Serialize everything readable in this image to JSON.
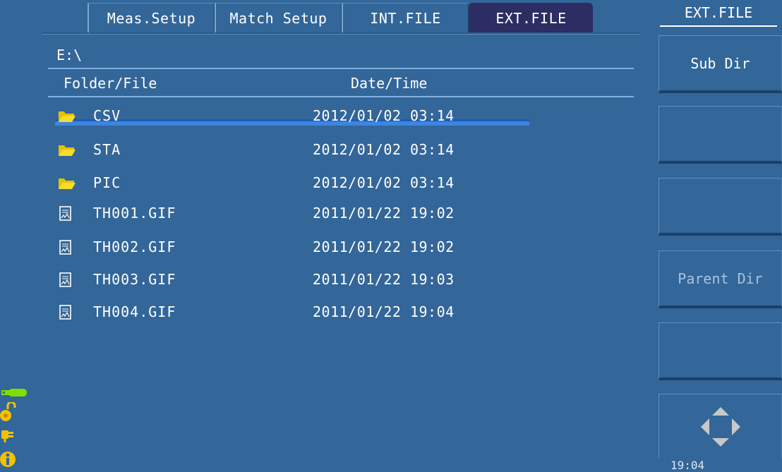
{
  "tabs": [
    {
      "label": "Meas.Setup"
    },
    {
      "label": "Match Setup"
    },
    {
      "label": "INT.FILE"
    },
    {
      "label": "EXT.FILE"
    }
  ],
  "path": "E:\\",
  "headers": {
    "name": "Folder/File",
    "date": "Date/Time"
  },
  "files": [
    {
      "name": "CSV",
      "date": "2012/01/02 03:14",
      "icon": "folder-icon"
    },
    {
      "name": "STA",
      "date": "2012/01/02 03:14",
      "icon": "folder-icon"
    },
    {
      "name": "PIC",
      "date": "2012/01/02 03:14",
      "icon": "folder-icon"
    },
    {
      "name": "TH001.GIF",
      "date": "2011/01/22 19:02",
      "icon": "image-file-icon"
    },
    {
      "name": "TH002.GIF",
      "date": "2011/01/22 19:02",
      "icon": "image-file-icon"
    },
    {
      "name": "TH003.GIF",
      "date": "2011/01/22 19:03",
      "icon": "image-file-icon"
    },
    {
      "name": "TH004.GIF",
      "date": "2011/01/22 19:04",
      "icon": "image-file-icon"
    }
  ],
  "side": {
    "title": "EXT.FILE",
    "keys": [
      {
        "label": "Sub Dir"
      },
      {
        "label": ""
      },
      {
        "label": ""
      },
      {
        "label": "Parent Dir"
      },
      {
        "label": ""
      }
    ]
  },
  "clock": "19:04",
  "colors": {
    "background": "#336699",
    "active_tab": "#2b2d63",
    "selection": "#3b86e0",
    "folder": "#f2d21a"
  }
}
